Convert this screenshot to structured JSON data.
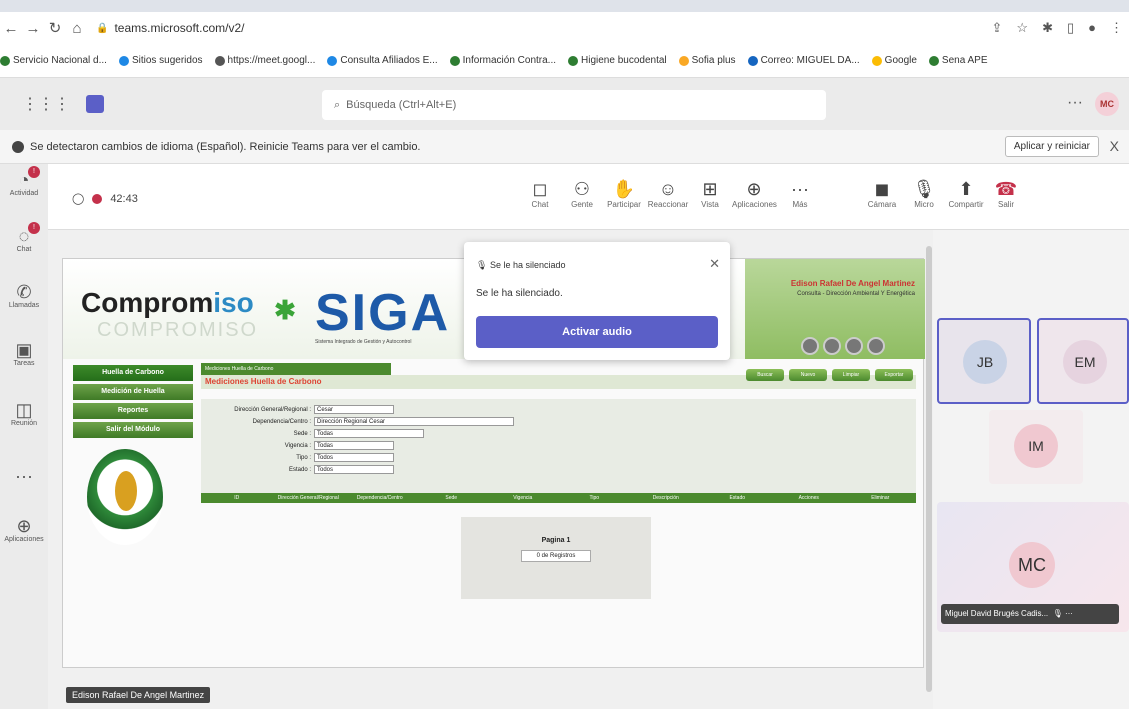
{
  "browser": {
    "url": "teams.microsoft.com/v2/"
  },
  "bookmarks": [
    {
      "label": "Servicio Nacional d...",
      "color": "#2e7d32"
    },
    {
      "label": "Sitios sugeridos",
      "color": "#1e88e5"
    },
    {
      "label": "https://meet.googl...",
      "color": "#555555"
    },
    {
      "label": "Consulta Afiliados E...",
      "color": "#1e88e5"
    },
    {
      "label": "Información Contra...",
      "color": "#2e7d32"
    },
    {
      "label": "Higiene bucodental",
      "color": "#2e7d32"
    },
    {
      "label": "Sofia plus",
      "color": "#f9a825"
    },
    {
      "label": "Correo: MIGUEL DA...",
      "color": "#1565c0"
    },
    {
      "label": "Google",
      "color": "#fbbc04"
    },
    {
      "label": "Sena APE",
      "color": "#2e7d32"
    }
  ],
  "teams": {
    "search_placeholder": "Búsqueda (Ctrl+Alt+E)",
    "me_initials": "MC",
    "more": "···"
  },
  "notice": {
    "text": "Se detectaron cambios de idioma (Español). Reinicie Teams para ver el cambio.",
    "apply": "Aplicar y reiniciar",
    "close": "X"
  },
  "rail": [
    {
      "label": "Actividad",
      "glyph": "◔",
      "badge": "!"
    },
    {
      "label": "Chat",
      "glyph": "◌",
      "badge": "!"
    },
    {
      "label": "Llamadas",
      "glyph": "✆",
      "badge": ""
    },
    {
      "label": "Tareas",
      "glyph": "▣",
      "badge": ""
    },
    {
      "label": "Reunión",
      "glyph": "◫",
      "badge": ""
    },
    {
      "label": "",
      "glyph": "···",
      "badge": ""
    },
    {
      "label": "Aplicaciones",
      "glyph": "⊕",
      "badge": ""
    }
  ],
  "meeting": {
    "timer": "42:43"
  },
  "toolbar": [
    {
      "label": "Chat",
      "glyph": "◻"
    },
    {
      "label": "Gente",
      "glyph": "⚇"
    },
    {
      "label": "Participar",
      "glyph": "✋"
    },
    {
      "label": "Reaccionar",
      "glyph": "☺"
    },
    {
      "label": "Vista",
      "glyph": "⊞"
    },
    {
      "label": "Aplicaciones",
      "glyph": "⊕"
    },
    {
      "label": "Más",
      "glyph": "···"
    },
    {
      "label": "Cámara",
      "glyph": "◼"
    },
    {
      "label": "Micro",
      "glyph": "🎙"
    },
    {
      "label": "Compartir",
      "glyph": "⬆"
    },
    {
      "label": "Salir",
      "glyph": "☎"
    }
  ],
  "popup": {
    "title": "Se le ha silenciado",
    "body": "Se le ha silenciado.",
    "button": "Activar audio",
    "close": "✕"
  },
  "siga": {
    "brand": "Compromiso",
    "brand_split": [
      "Comprom",
      "iso"
    ],
    "brand_mirror": "COMPROMISO",
    "sena": "SENA",
    "word": "SIGA",
    "tagline": "Sistema Integrado de Gestión y Autocontrol",
    "user": "Edison Rafael De Angel Martinez",
    "user_role": "Consulta - Dirección Ambiental Y Energética",
    "nav": [
      "Huella de Carbono",
      "Medición de Huella",
      "Reportes",
      "Salir del Módulo"
    ],
    "breadcrumb": "Mediciones Huella de Carbono",
    "section_title": "Mediciones Huella de Carbono",
    "actions": [
      "Buscar",
      "Nuevo",
      "Limpiar",
      "Exportar"
    ],
    "filters": [
      {
        "label": "Dirección General/Regional :",
        "value": "Cesar"
      },
      {
        "label": "Dependencia/Centro :",
        "value": "Dirección Regional Cesar"
      },
      {
        "label": "Sede :",
        "value": "Todas"
      },
      {
        "label": "Vigencia :",
        "value": "Todas"
      },
      {
        "label": "Tipo :",
        "value": "Todos"
      },
      {
        "label": "Estado :",
        "value": "Todos"
      }
    ],
    "columns": [
      "ID",
      "Dirección General/Regional",
      "Dependencia/Centro",
      "Sede",
      "Vigencia",
      "Tipo",
      "Descripción",
      "Estado",
      "Acciones",
      "Eliminar"
    ],
    "pager_title": "Pagina 1",
    "pager_records": "0 de Registros"
  },
  "sharer": "Edison Rafael De Angel Martinez",
  "participants": [
    {
      "initials": "JB",
      "color": "#c9d3e6"
    },
    {
      "initials": "EM",
      "color": "#e6d3df"
    },
    {
      "initials": "IM",
      "color": "#f0c8d0"
    },
    {
      "initials": "MC",
      "color": "#f0c8d0"
    }
  ],
  "mc_name": "Miguel David Brugés Cadis..."
}
